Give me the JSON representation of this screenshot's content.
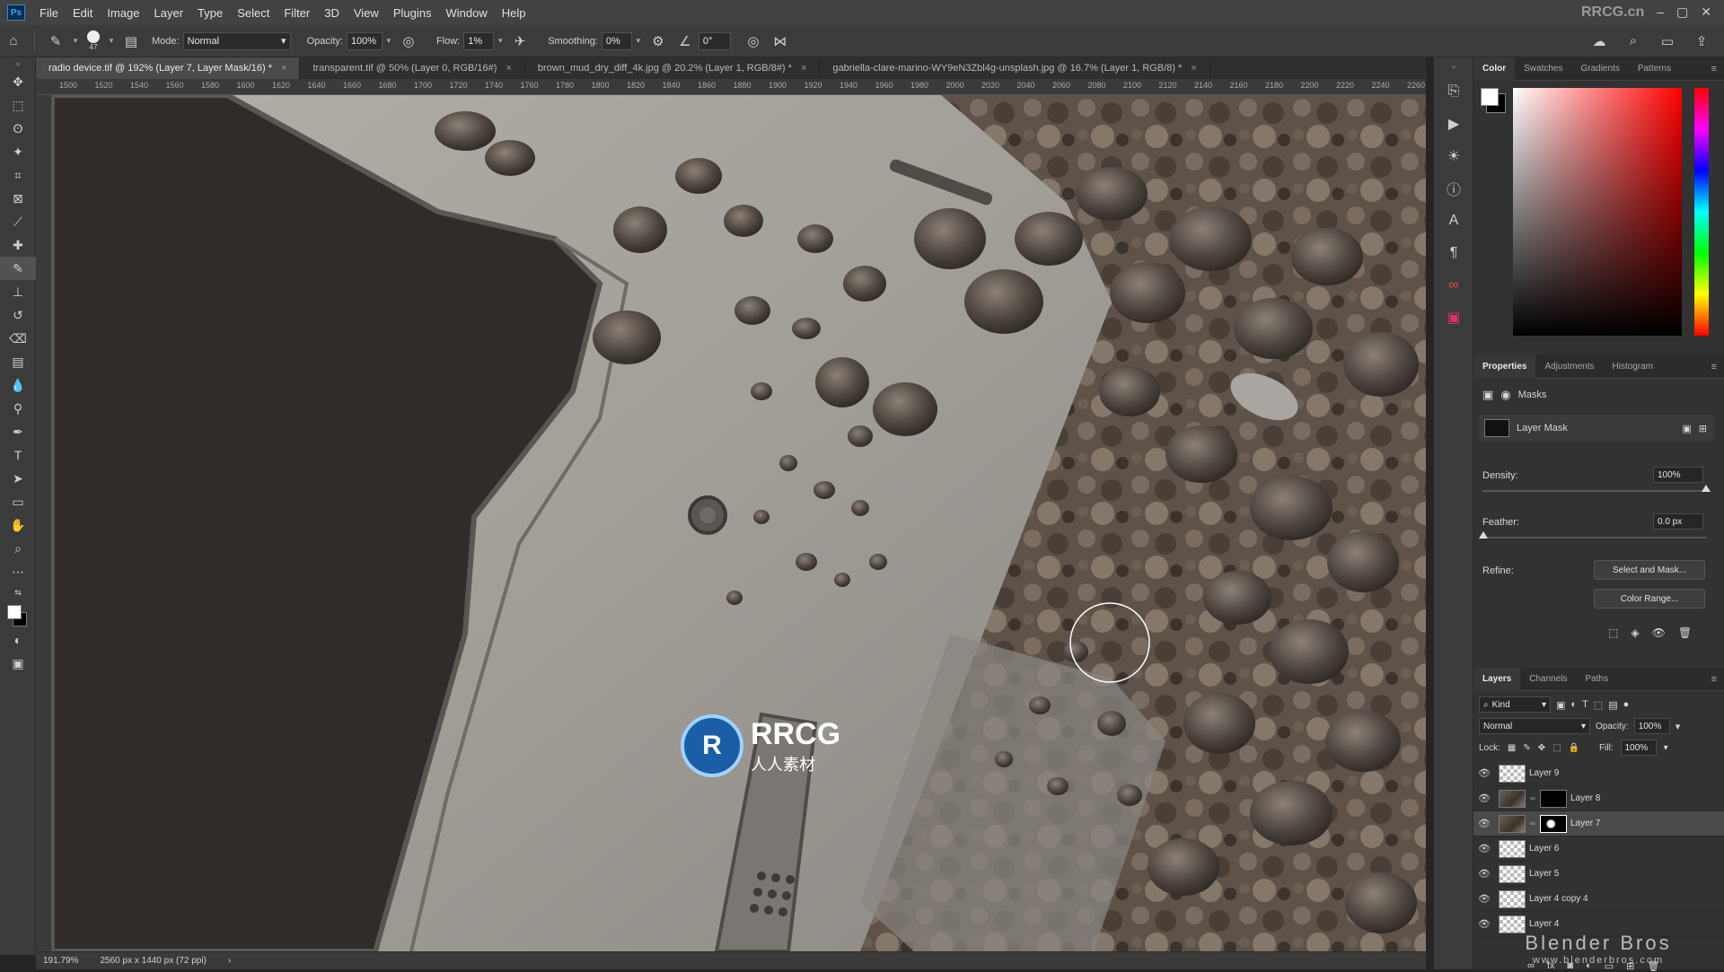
{
  "menubar": {
    "logo": "Ps",
    "items": [
      "File",
      "Edit",
      "Image",
      "Layer",
      "Type",
      "Select",
      "Filter",
      "3D",
      "View",
      "Plugins",
      "Window",
      "Help"
    ]
  },
  "options": {
    "brush_size": "47",
    "mode_label": "Mode:",
    "mode_value": "Normal",
    "opacity_label": "Opacity:",
    "opacity_value": "100%",
    "flow_label": "Flow:",
    "flow_value": "1%",
    "smoothing_label": "Smoothing:",
    "smoothing_value": "0%",
    "angle_value": "0°"
  },
  "tabs": [
    {
      "label": "radio device.tif @ 192% (Layer 7, Layer Mask/16) *",
      "active": true
    },
    {
      "label": "transparent.tif @ 50% (Layer 0, RGB/16#)",
      "active": false
    },
    {
      "label": "brown_mud_dry_diff_4k.jpg @ 20.2% (Layer 1, RGB/8#) *",
      "active": false
    },
    {
      "label": "gabriella-clare-marino-WY9eN3Zbl4g-unsplash.jpg @ 16.7% (Layer 1, RGB/8) *",
      "active": false
    }
  ],
  "ruler": {
    "marks": [
      "1500",
      "1520",
      "1540",
      "1560",
      "1580",
      "1600",
      "1620",
      "1640",
      "1660",
      "1680",
      "1700",
      "1720",
      "1740",
      "1760",
      "1780",
      "1800",
      "1820",
      "1840",
      "1860",
      "1880",
      "1900",
      "1920",
      "1940",
      "1960",
      "1980",
      "2000",
      "2020",
      "2040",
      "2060",
      "2080",
      "2100",
      "2120",
      "2140",
      "2160",
      "2180",
      "2200",
      "2220",
      "2240",
      "2260"
    ]
  },
  "status": {
    "zoom": "191.79%",
    "doc_size": "2560 px x 1440 px (72 ppi)"
  },
  "color_panel": {
    "tabs": [
      "Color",
      "Swatches",
      "Gradients",
      "Patterns"
    ],
    "active": "Color",
    "foreground": "#ffffff",
    "background": "#000000"
  },
  "properties_panel": {
    "tabs": [
      "Properties",
      "Adjustments",
      "Histogram"
    ],
    "section": "Masks",
    "mask_label": "Layer Mask",
    "density_label": "Density:",
    "density_value": "100%",
    "feather_label": "Feather:",
    "feather_value": "0.0 px",
    "refine_label": "Refine:",
    "select_mask_btn": "Select and Mask...",
    "color_range_btn": "Color Range..."
  },
  "layers_panel": {
    "tabs": [
      "Layers",
      "Channels",
      "Paths"
    ],
    "kind_label": "Kind",
    "blend_mode": "Normal",
    "opacity_label": "Opacity:",
    "opacity_value": "100%",
    "lock_label": "Lock:",
    "fill_label": "Fill:",
    "fill_value": "100%",
    "layers": [
      {
        "name": "Layer 9",
        "thumb": "checker",
        "mask": false,
        "selected": false
      },
      {
        "name": "Layer 8",
        "thumb": "tex",
        "mask": true,
        "selected": false
      },
      {
        "name": "Layer 7",
        "thumb": "tex",
        "mask": true,
        "selected": true
      },
      {
        "name": "Layer 6",
        "thumb": "checker",
        "mask": false,
        "selected": false
      },
      {
        "name": "Layer 5",
        "thumb": "checker",
        "mask": false,
        "selected": false
      },
      {
        "name": "Layer 4 copy 4",
        "thumb": "checker",
        "mask": false,
        "selected": false
      },
      {
        "name": "Layer 4",
        "thumb": "checker",
        "mask": false,
        "selected": false
      }
    ]
  },
  "watermarks": {
    "corner": "RRCG.cn",
    "center_en": "RRCG",
    "center_cn": "人人素材",
    "brand": "Blender Bros",
    "brand_url": "www.blenderbros.com"
  }
}
